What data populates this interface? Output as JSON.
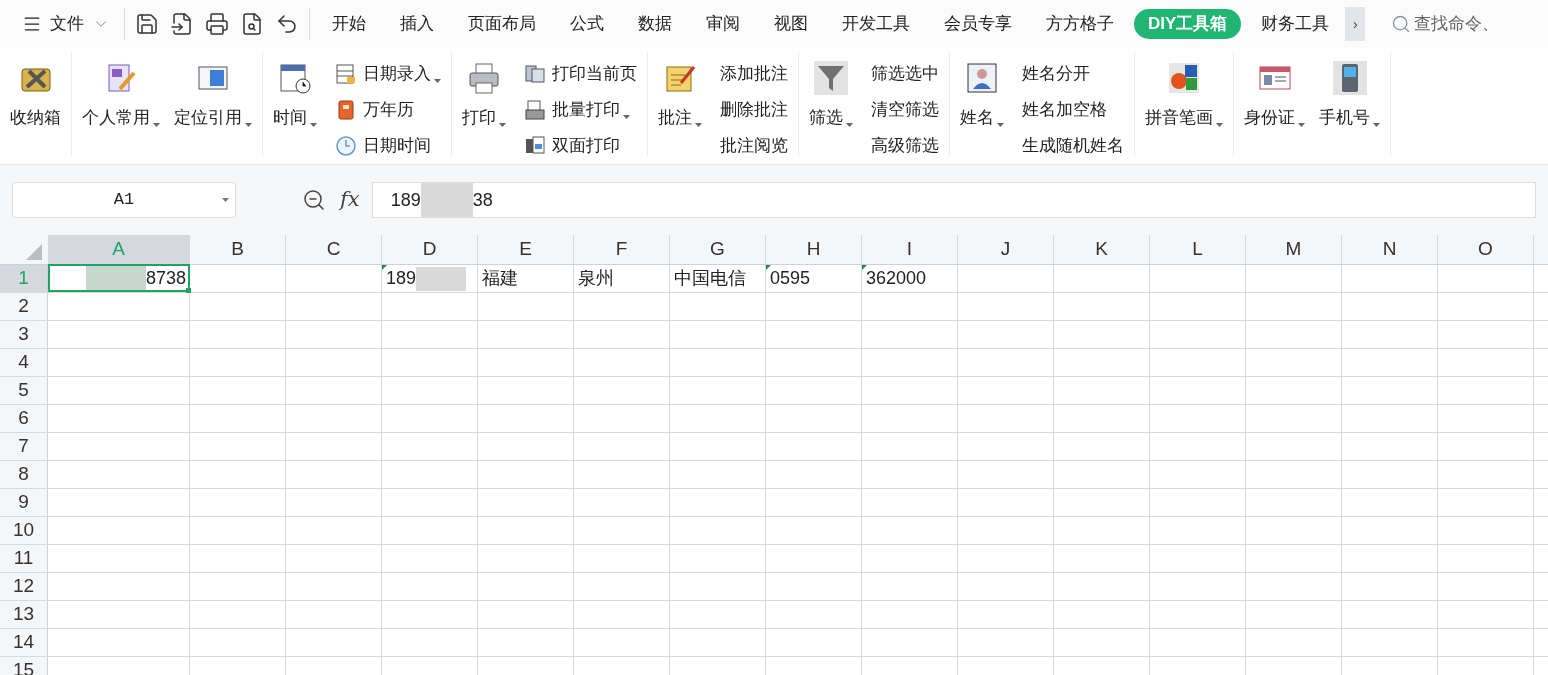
{
  "menu": {
    "label": "文件"
  },
  "tabs": [
    {
      "label": "开始",
      "selected": false
    },
    {
      "label": "插入",
      "selected": false
    },
    {
      "label": "页面布局",
      "selected": false
    },
    {
      "label": "公式",
      "selected": false
    },
    {
      "label": "数据",
      "selected": false
    },
    {
      "label": "审阅",
      "selected": false
    },
    {
      "label": "视图",
      "selected": false
    },
    {
      "label": "开发工具",
      "selected": false
    },
    {
      "label": "会员专享",
      "selected": false
    },
    {
      "label": "方方格子",
      "selected": false
    },
    {
      "label": "DIY工具箱",
      "selected": true
    },
    {
      "label": "财务工具",
      "selected": false
    }
  ],
  "more_tabs": "›",
  "search": {
    "placeholder": "查找命令、"
  },
  "ribbon": [
    {
      "large": [
        {
          "label": "收纳箱",
          "dropdown": false
        }
      ]
    },
    {
      "large": [
        {
          "label": "个人常用",
          "dropdown": true
        },
        {
          "label": "定位引用",
          "dropdown": true
        }
      ]
    },
    {
      "large": [
        {
          "label": "时间",
          "dropdown": true
        }
      ],
      "stack": [
        {
          "label": "日期录入",
          "dropdown": true
        },
        {
          "label": "万年历",
          "dropdown": false
        },
        {
          "label": "日期时间",
          "dropdown": false
        }
      ]
    },
    {
      "large": [
        {
          "label": "打印",
          "dropdown": true
        }
      ],
      "stack": [
        {
          "label": "打印当前页",
          "dropdown": false
        },
        {
          "label": "批量打印",
          "dropdown": true
        },
        {
          "label": "双面打印",
          "dropdown": false
        }
      ]
    },
    {
      "large": [
        {
          "label": "批注",
          "dropdown": true
        }
      ],
      "stack": [
        {
          "label": "添加批注",
          "dropdown": false
        },
        {
          "label": "删除批注",
          "dropdown": false
        },
        {
          "label": "批注阅览",
          "dropdown": false
        }
      ]
    },
    {
      "large": [
        {
          "label": "筛选",
          "dropdown": true
        }
      ],
      "stack": [
        {
          "label": "筛选选中",
          "dropdown": false
        },
        {
          "label": "清空筛选",
          "dropdown": false
        },
        {
          "label": "高级筛选",
          "dropdown": false
        }
      ]
    },
    {
      "large": [
        {
          "label": "姓名",
          "dropdown": true
        }
      ],
      "stack": [
        {
          "label": "姓名分开",
          "dropdown": false
        },
        {
          "label": "姓名加空格",
          "dropdown": false
        },
        {
          "label": "生成随机姓名",
          "dropdown": false
        }
      ]
    },
    {
      "large": [
        {
          "label": "拼音笔画",
          "dropdown": true
        }
      ]
    },
    {
      "large": [
        {
          "label": "身份证",
          "dropdown": true
        },
        {
          "label": "手机号",
          "dropdown": true
        }
      ]
    }
  ],
  "name_box": "A1",
  "formula": {
    "fx": "fx",
    "value_start": "189",
    "value_end": "38"
  },
  "columns": [
    {
      "label": "A",
      "selected": true
    },
    {
      "label": "B",
      "selected": false
    },
    {
      "label": "C",
      "selected": false
    },
    {
      "label": "D",
      "selected": false
    },
    {
      "label": "E",
      "selected": false
    },
    {
      "label": "F",
      "selected": false
    },
    {
      "label": "G",
      "selected": false
    },
    {
      "label": "H",
      "selected": false
    },
    {
      "label": "I",
      "selected": false
    },
    {
      "label": "J",
      "selected": false
    },
    {
      "label": "K",
      "selected": false
    },
    {
      "label": "L",
      "selected": false
    },
    {
      "label": "M",
      "selected": false
    },
    {
      "label": "N",
      "selected": false
    },
    {
      "label": "O",
      "selected": false
    }
  ],
  "rows": [
    {
      "label": "1",
      "selected": true,
      "cells": [
        {
          "text": "8738",
          "kind": "number",
          "flag": false,
          "masked": true,
          "active": true
        },
        null,
        null,
        {
          "text": "189",
          "kind": "text",
          "flag": true,
          "masked": true,
          "active": false
        },
        {
          "text": "福建",
          "kind": "text",
          "flag": false,
          "masked": false,
          "active": false
        },
        {
          "text": "泉州",
          "kind": "text",
          "flag": false,
          "masked": false,
          "active": false
        },
        {
          "text": "中国电信",
          "kind": "text",
          "flag": false,
          "masked": false,
          "active": false
        },
        {
          "text": "0595",
          "kind": "text",
          "flag": true,
          "masked": false,
          "active": false
        },
        {
          "text": "362000",
          "kind": "text",
          "flag": true,
          "masked": false,
          "active": false
        }
      ]
    },
    {
      "label": "2",
      "selected": false,
      "cells": []
    },
    {
      "label": "3",
      "selected": false,
      "cells": []
    },
    {
      "label": "4",
      "selected": false,
      "cells": []
    },
    {
      "label": "5",
      "selected": false,
      "cells": []
    },
    {
      "label": "6",
      "selected": false,
      "cells": []
    },
    {
      "label": "7",
      "selected": false,
      "cells": []
    },
    {
      "label": "8",
      "selected": false,
      "cells": []
    },
    {
      "label": "9",
      "selected": false,
      "cells": []
    },
    {
      "label": "10",
      "selected": false,
      "cells": []
    },
    {
      "label": "11",
      "selected": false,
      "cells": []
    },
    {
      "label": "12",
      "selected": false,
      "cells": []
    },
    {
      "label": "13",
      "selected": false,
      "cells": []
    },
    {
      "label": "14",
      "selected": false,
      "cells": []
    },
    {
      "label": "15",
      "selected": false,
      "cells": []
    }
  ]
}
